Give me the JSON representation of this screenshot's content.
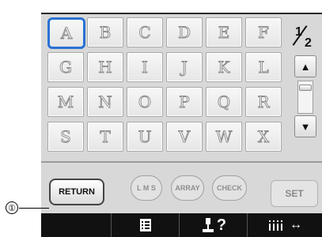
{
  "keys": [
    "A",
    "B",
    "C",
    "D",
    "E",
    "F",
    "G",
    "H",
    "I",
    "J",
    "K",
    "L",
    "M",
    "N",
    "O",
    "P",
    "Q",
    "R",
    "S",
    "T",
    "U",
    "V",
    "W",
    "X"
  ],
  "page": {
    "current": "1",
    "total": "2"
  },
  "scroll_up": "▲",
  "scroll_down": "▼",
  "buttons": {
    "return": "RETURN",
    "lms": "L M S",
    "array": "ARRAY",
    "check": "CHECK",
    "set": "SET"
  },
  "navbar": {
    "help": "?",
    "spacing_arrow": "↔"
  },
  "callout": "①"
}
